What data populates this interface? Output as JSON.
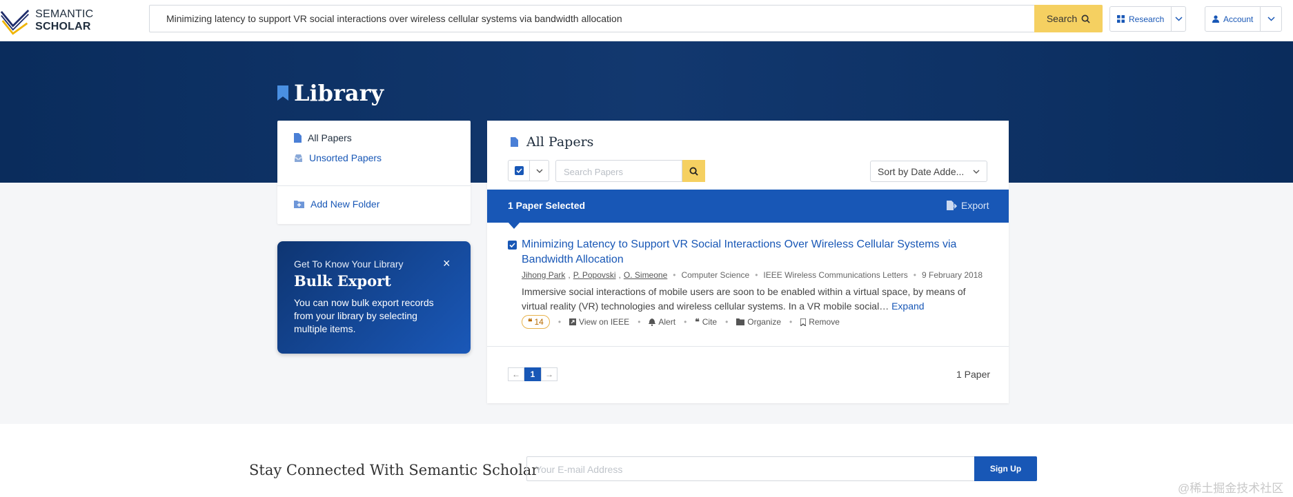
{
  "header": {
    "logo_prefix": "SEMANTIC",
    "logo_bold": "SCHOLAR",
    "search_value": "Minimizing latency to support VR social interactions over wireless cellular systems via bandwidth allocation",
    "search_button": "Search",
    "research_label": "Research",
    "account_label": "Account"
  },
  "page": {
    "title": "Library"
  },
  "sidebar": {
    "items": [
      {
        "label": "All Papers",
        "icon": "document-icon"
      },
      {
        "label": "Unsorted Papers",
        "icon": "inbox-icon"
      }
    ],
    "add_folder": "Add New Folder"
  },
  "promo": {
    "kicker": "Get To Know Your Library",
    "title": "Bulk Export",
    "body": "You can now bulk export records from your library by selecting multiple items.",
    "close": "×"
  },
  "main": {
    "title": "All Papers",
    "search_placeholder": "Search Papers",
    "sort_label": "Sort by Date Adde...",
    "selected_text": "1 Paper Selected",
    "export_label": "Export",
    "paper": {
      "title": "Minimizing Latency to Support VR Social Interactions Over Wireless Cellular Systems via Bandwidth Allocation",
      "authors": [
        "Jihong Park",
        "P. Popovski",
        "O. Simeone"
      ],
      "field": "Computer Science",
      "venue": "IEEE Wireless Communications Letters",
      "date": "9 February 2018",
      "abstract": "Immersive social interactions of mobile users are soon to be enabled within a virtual space, by means of virtual reality (VR) technologies and wireless cellular systems. In a VR mobile social…",
      "expand": "Expand",
      "citations": "14",
      "actions": [
        "View on IEEE",
        "Alert",
        "Cite",
        "Organize",
        "Remove"
      ]
    },
    "pager": {
      "prev": "←",
      "current": "1",
      "next": "→"
    },
    "total": "1 Paper"
  },
  "footer": {
    "heading": "Stay Connected With Semantic Scholar",
    "email_placeholder": "Your E-mail Address",
    "signup": "Sign Up",
    "watermark": "@稀土掘金技术社区"
  },
  "colors": {
    "accent": "#1857b6",
    "search_yellow": "#f5d061",
    "hero_navy": "#0a2c5c"
  }
}
